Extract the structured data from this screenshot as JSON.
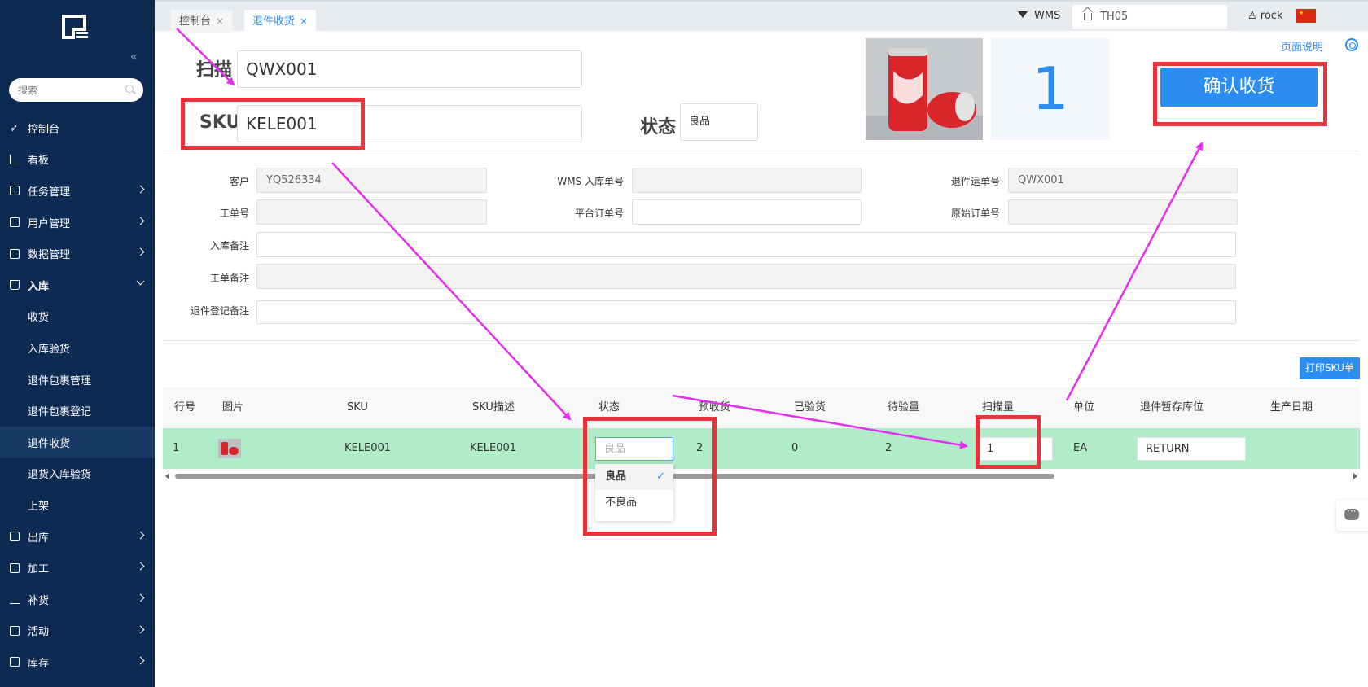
{
  "sidebar": {
    "search_placeholder": "搜索",
    "collapse_icon": "«",
    "items": [
      {
        "label": "控制台"
      },
      {
        "label": "看板"
      },
      {
        "label": "任务管理"
      },
      {
        "label": "用户管理"
      },
      {
        "label": "数据管理"
      },
      {
        "label": "入库"
      },
      {
        "label": "收货"
      },
      {
        "label": "入库验货"
      },
      {
        "label": "退件包裹管理"
      },
      {
        "label": "退件包裹登记"
      },
      {
        "label": "退件收货"
      },
      {
        "label": "退货入库验货"
      },
      {
        "label": "上架"
      },
      {
        "label": "出库"
      },
      {
        "label": "加工"
      },
      {
        "label": "补货"
      },
      {
        "label": "活动"
      },
      {
        "label": "库存"
      }
    ]
  },
  "topbar": {
    "tabs": [
      {
        "label": "控制台",
        "close": "×"
      },
      {
        "label": "退件收货",
        "close": "×"
      }
    ],
    "system": "WMS",
    "warehouse": "TH05",
    "user": "rock",
    "flag_star": "★"
  },
  "scan": {
    "scan_label": "扫描",
    "scan_value": "QWX001",
    "sku_label": "SKU",
    "sku_value": "KELE001",
    "status_label": "状态",
    "status_value": "良品",
    "count": "1",
    "confirm_label": "确认收货",
    "help_link": "页面说明"
  },
  "form": {
    "customer_label": "客户",
    "customer_value": "YQ526334",
    "wms_inbound_label": "WMS 入库单号",
    "wms_inbound_value": "",
    "return_tracking_label": "退件运单号",
    "return_tracking_value": "QWX001",
    "work_order_label": "工单号",
    "platform_order_label": "平台订单号",
    "original_order_label": "原始订单号",
    "inbound_remark_label": "入库备注",
    "work_order_remark_label": "工单备注",
    "return_register_remark_label": "退件登记备注"
  },
  "table": {
    "print_button": "打印SKU单",
    "headers": [
      "行号",
      "图片",
      "SKU",
      "SKU描述",
      "状态",
      "预收货",
      "已验货",
      "待验量",
      "扫描量",
      "单位",
      "退件暂存库位",
      "生产日期"
    ],
    "row": {
      "line": "1",
      "sku": "KELE001",
      "desc": "KELE001",
      "status_placeholder": "良品",
      "expected": "2",
      "inspected": "0",
      "pending": "2",
      "scanned": "1",
      "unit": "EA",
      "location": "RETURN"
    },
    "status_options": [
      {
        "label": "良品",
        "check": "✓"
      },
      {
        "label": "不良品"
      }
    ]
  },
  "colors": {
    "sidebar": "#0c2a52",
    "accent": "#2d8cf0",
    "row_highlight": "#b1ecc9",
    "annotation_red": "#e8333a",
    "annotation_arrow": "#e62ef0"
  }
}
